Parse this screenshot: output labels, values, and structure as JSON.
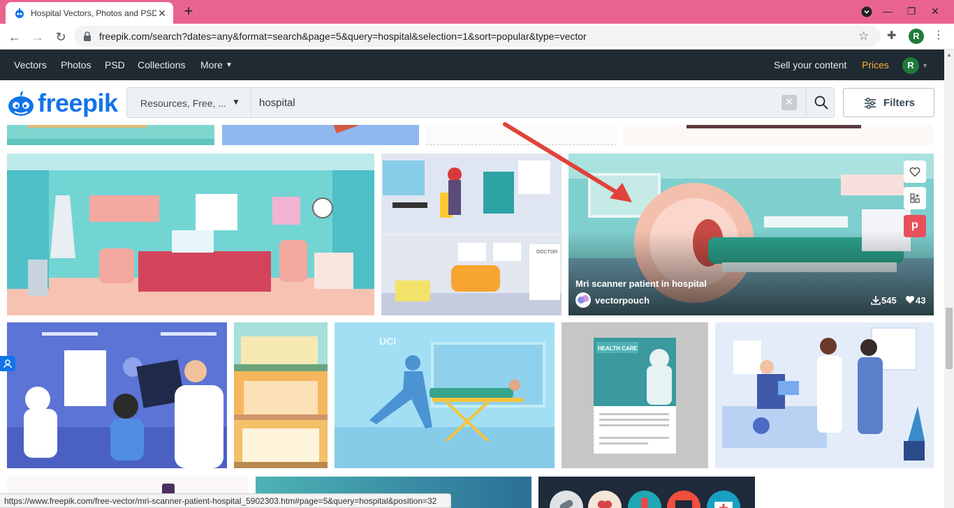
{
  "browser": {
    "tab_title": "Hospital Vectors, Photos and PSD",
    "url": "freepik.com/search?dates=any&format=search&page=5&query=hospital&selection=1&sort=popular&type=vector",
    "profile_initial": "R",
    "status_url": "https://www.freepik.com/free-vector/mri-scanner-patient-hospital_5902303.htm#page=5&query=hospital&position=32"
  },
  "topnav": {
    "items": [
      "Vectors",
      "Photos",
      "PSD",
      "Collections",
      "More"
    ],
    "sell": "Sell your content",
    "prices": "Prices",
    "user_initial": "R"
  },
  "search": {
    "logo": "freepik",
    "resource_filter": "Resources, Free, ...",
    "query": "hospital",
    "filters_label": "Filters"
  },
  "featured": {
    "title": "Mri scanner patient in hospital",
    "author": "vectorpouch",
    "downloads": "545",
    "likes": "43"
  },
  "thumbs": {
    "uci_label": "UCI",
    "health_care": "HEALTH CARE",
    "doctor_sign": "DOCTOR"
  },
  "colors": {
    "brand": "#1273eb",
    "topnav_bg": "#1f2a33",
    "prices": "#f9b233",
    "tab_strip": "#e8648e",
    "pinterest": "#e8505b"
  }
}
